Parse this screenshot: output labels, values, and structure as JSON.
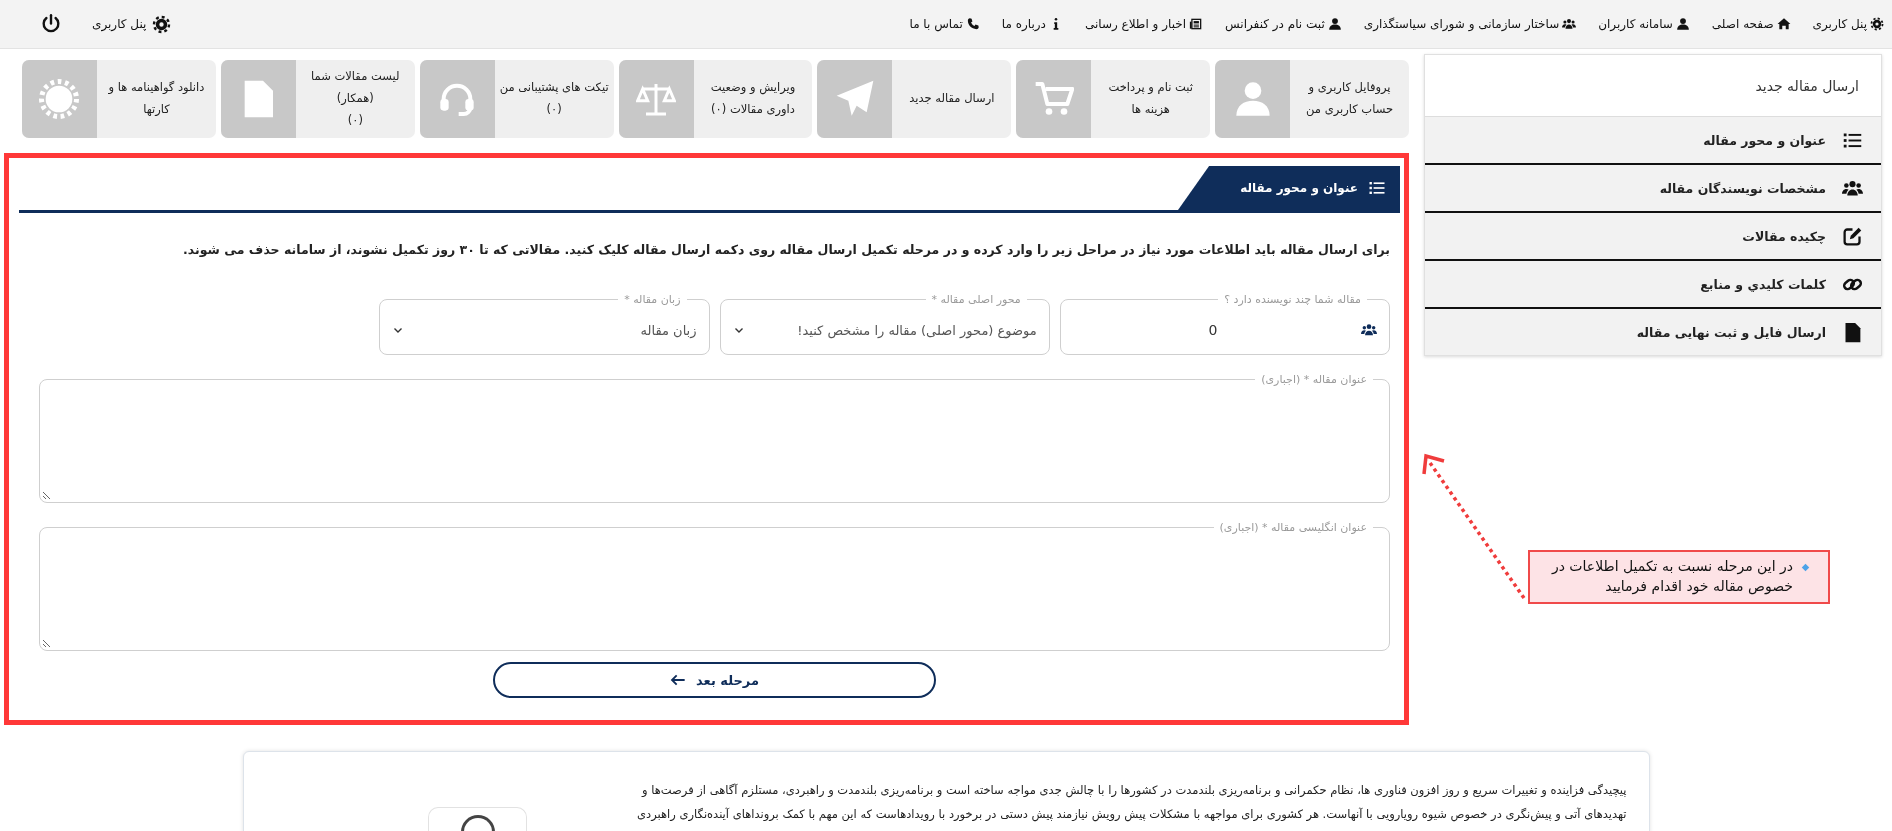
{
  "top_nav": {
    "items": [
      {
        "label": "پنل کاربری",
        "kind": "settings"
      },
      {
        "label": "صفحه اصلی",
        "kind": "home"
      },
      {
        "label": "سامانه کاربران",
        "kind": "user"
      },
      {
        "label": "ساختار سازمانی و شورای سیاستگذاری",
        "kind": "group"
      },
      {
        "label": "ثبت نام در کنفرانس",
        "kind": "user"
      },
      {
        "label": "اخبار و اطلاع رسانی",
        "kind": "news"
      },
      {
        "label": "درباره ما",
        "kind": "info"
      },
      {
        "label": "تماس با ما",
        "kind": "phone"
      }
    ],
    "user_panel": {
      "label": "پنل کاربری"
    }
  },
  "sidebar": {
    "title": "ارسال مقاله جدید",
    "items": [
      {
        "label": "عنوان و محور مقاله",
        "kind": "list"
      },
      {
        "label": "مشخصات نویسندگان مقاله",
        "kind": "group"
      },
      {
        "label": "چکیده مقالات",
        "kind": "edit"
      },
      {
        "label": "کلمات کلیدي و منابع",
        "kind": "link"
      },
      {
        "label": "ارسال فایل و ثبت نهایی مقاله",
        "kind": "word"
      }
    ]
  },
  "tiles": [
    {
      "label": "پروفایل کاربری و حساب کاربری من",
      "kind": "user"
    },
    {
      "label": "ثبت نام و پرداخت هزینه ها",
      "kind": "cart"
    },
    {
      "label": "ارسال مقاله جدید",
      "kind": "send"
    },
    {
      "label": "ویرایش و وضعیت داوری مقالات (۰)",
      "kind": "scales"
    },
    {
      "label": "تیکت های پشتیبانی من",
      "count": "(۰)",
      "kind": "headset"
    },
    {
      "label": "لیست مقالات شما (همکار)",
      "count": "(۰)",
      "kind": "word"
    },
    {
      "label": "دانلود گواهینامه ها و کارتها",
      "kind": "seal"
    }
  ],
  "form": {
    "section_tab": {
      "label": "عنوان و محور مقاله"
    },
    "instructions": "برای ارسال مقاله باید اطلاعات مورد نیاز در مراحل زیر را وارد کرده و در مرحله تکمیل ارسال مقاله روی دکمه ارسال مقاله کلیک کنید. مقالاتی که تا ۳۰ روز تکمیل نشوند، از سامانه حذف می شوند.",
    "fields": [
      {
        "kind": "number",
        "legend": "مقاله شما چند نویسنده دارد ؟",
        "value": "0"
      },
      {
        "kind": "select",
        "legend": "محور اصلی مقاله *",
        "value": "موضوع (محور اصلی) مقاله را مشخص کنید!"
      },
      {
        "kind": "select",
        "legend": "زبان مقاله *",
        "value": "زبان مقاله"
      },
      {
        "kind": "textarea",
        "legend": "عنوان مقاله * (اجباری)"
      },
      {
        "kind": "textarea",
        "legend": "عنوان انگلیسی مقاله * (اجباری)"
      }
    ],
    "next_button": {
      "label": "مرحله بعد"
    }
  },
  "callout": {
    "text": "در این مرحله نسبت به تکمیل اطلاعات در خصوص مقاله خود اقدام فرمایید"
  },
  "footer": {
    "paragraph_lines": [
      "پیچیدگی فزاینده و تغییرات سریع و روز افزون فناوری ها، نظام حکمرانی و برنامه‌ریزی بلندمدت در کشورها را با چالش جدی مواجه ساخته است و برنامه‌ریزی بلندمدت و راهبردی، مستلزم آگاهی از فرصت‌ها و",
      "تهدیدهای آتی و پیش‌نگری در خصوص شیوه رویارویی با آنهاست. هر کشوری برای مواجهه با مشکلات پیش رویش نیازمند پیش دستی در برخورد با رویدادهاست که این مهم با کمک برونداهای آینده‌نگاری راهبردی"
    ]
  }
}
